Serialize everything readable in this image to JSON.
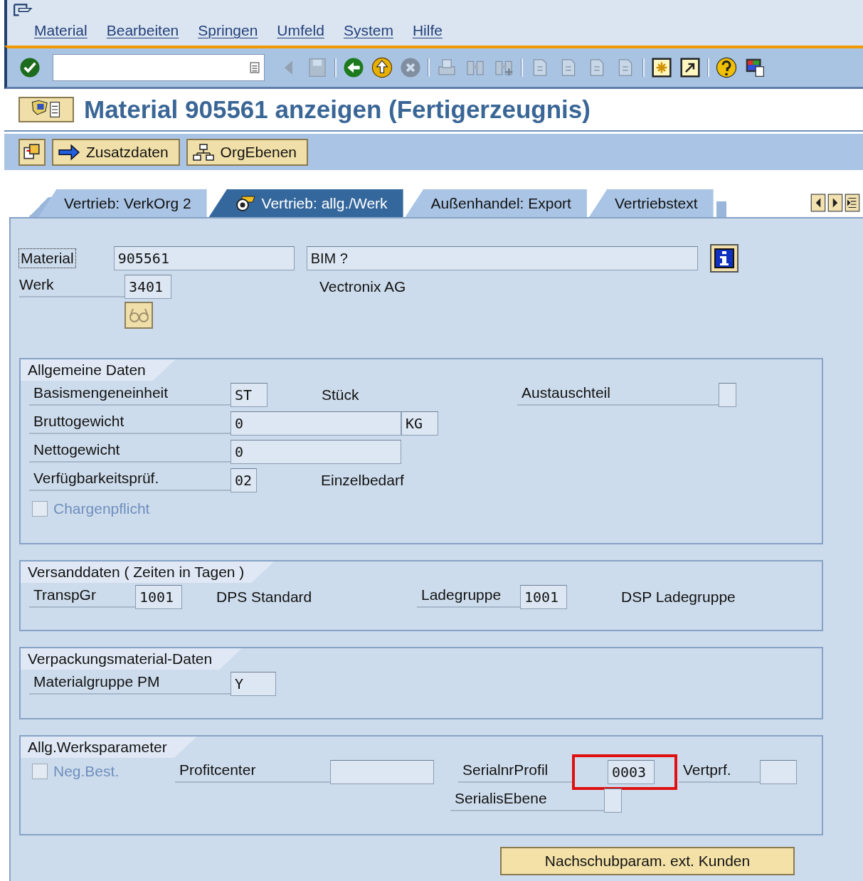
{
  "menu": [
    "Material",
    "Bearbeiten",
    "Springen",
    "Umfeld",
    "System",
    "Hilfe"
  ],
  "toolbar": [
    {
      "kind": "check",
      "disabled": false
    },
    {
      "kind": "command"
    },
    {
      "kind": "triangle-left",
      "disabled": true
    },
    {
      "kind": "floppy",
      "disabled": true
    },
    {
      "kind": "separator"
    },
    {
      "kind": "back",
      "disabled": false
    },
    {
      "kind": "up",
      "disabled": false
    },
    {
      "kind": "cancel",
      "disabled": true
    },
    {
      "kind": "separator"
    },
    {
      "kind": "printer",
      "disabled": true
    },
    {
      "kind": "binoculars",
      "disabled": true
    },
    {
      "kind": "binoculars-plus",
      "disabled": true
    },
    {
      "kind": "separator"
    },
    {
      "kind": "page",
      "disabled": true
    },
    {
      "kind": "page",
      "disabled": true
    },
    {
      "kind": "page",
      "disabled": true
    },
    {
      "kind": "page",
      "disabled": true
    },
    {
      "kind": "separator"
    },
    {
      "kind": "window-star",
      "disabled": false
    },
    {
      "kind": "window-arrow",
      "disabled": false
    },
    {
      "kind": "separator"
    },
    {
      "kind": "help",
      "disabled": false
    },
    {
      "kind": "monitor",
      "disabled": false
    }
  ],
  "title": "Material 905561 anzeigen (Fertigerzeugnis)",
  "app_toolbar": [
    {
      "kind": "icon"
    },
    {
      "kind": "arrow",
      "label": "Zusatzdaten"
    },
    {
      "kind": "tree",
      "label": "OrgEbenen"
    }
  ],
  "tabs": [
    {
      "label": "Vertrieb: VerkOrg 2",
      "selected": false,
      "icon": false
    },
    {
      "label": "Vertrieb: allg./Werk",
      "selected": true,
      "icon": true
    },
    {
      "label": "Außenhandel: Export",
      "selected": false,
      "icon": false
    },
    {
      "label": "Vertriebstext",
      "selected": false,
      "icon": false
    }
  ],
  "header": {
    "material": {
      "label": "Material",
      "value": "905561",
      "description": "BIM ?"
    },
    "plant": {
      "label": "Werk",
      "value": "3401",
      "description": "Vectronix AG"
    }
  },
  "general": {
    "title": "Allgemeine Daten",
    "base_unit": {
      "label": "Basismengeneinheit",
      "value": "ST",
      "text": "Stück"
    },
    "exchange_part": {
      "label": "Austauschteil"
    },
    "gross_weight": {
      "label": "Bruttogewicht",
      "value": "0",
      "unit": "KG"
    },
    "net_weight": {
      "label": "Nettogewicht",
      "value": "0"
    },
    "availability": {
      "label": "Verfügbarkeitsprüf.",
      "value": "02",
      "text": "Einzelbedarf"
    },
    "batch": {
      "label": "Chargenpflicht",
      "checked": false,
      "disabled": true
    }
  },
  "shipping": {
    "title": "Versanddaten ( Zeiten in Tagen )",
    "transport": {
      "label": "TranspGr",
      "value": "1001",
      "text": "DPS Standard"
    },
    "loading": {
      "label": "Ladegruppe",
      "value": "1001",
      "text": "DSP Ladegruppe"
    }
  },
  "packaging": {
    "title": "Verpackungsmaterial-Daten",
    "group": {
      "label": "Materialgruppe PM",
      "value": "Y"
    }
  },
  "plant_params": {
    "title": "Allg.Werksparameter",
    "neg_stock": {
      "label": "Neg.Best.",
      "checked": false,
      "disabled": true
    },
    "profit_center": {
      "label": "Profitcenter"
    },
    "serial_profile": {
      "label": "SerialnrProfil",
      "value": "0003",
      "highlighted": true
    },
    "dist_profile": {
      "label": "Vertprf."
    },
    "serial_level": {
      "label": "SerialisEbene"
    }
  },
  "bottom_button": "Nachschubparam. ext. Kunden"
}
